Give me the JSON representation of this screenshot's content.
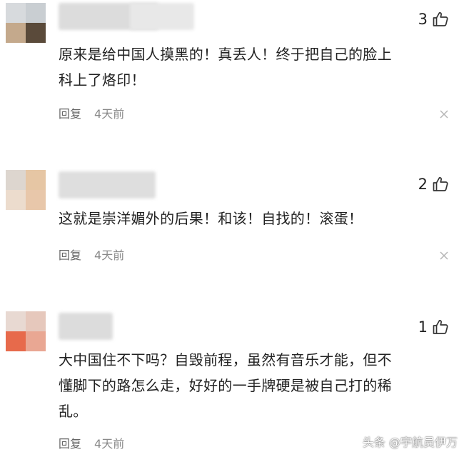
{
  "comments": [
    {
      "likes": "3",
      "text": "原来是给中国人摸黑的！真丢人！终于把自己的脸上\n科上了烙印！",
      "reply_label": "回复",
      "time": "4天前"
    },
    {
      "likes": "2",
      "text": "这就是崇洋媚外的后果！和该！自找的！滚蛋！",
      "reply_label": "回复",
      "time": "4天前"
    },
    {
      "likes": "1",
      "text": "大中国住不下吗？自毁前程，虽然有音乐才能，但不\n懂脚下的路怎么走，好好的一手牌硬是被自己打的稀\n乱。",
      "reply_label": "回复",
      "time": "4天前"
    }
  ],
  "watermark": "头条 @宇航员伊万",
  "colors": {
    "text": "#222222",
    "meta": "#8a8a8a",
    "background": "#ffffff"
  }
}
